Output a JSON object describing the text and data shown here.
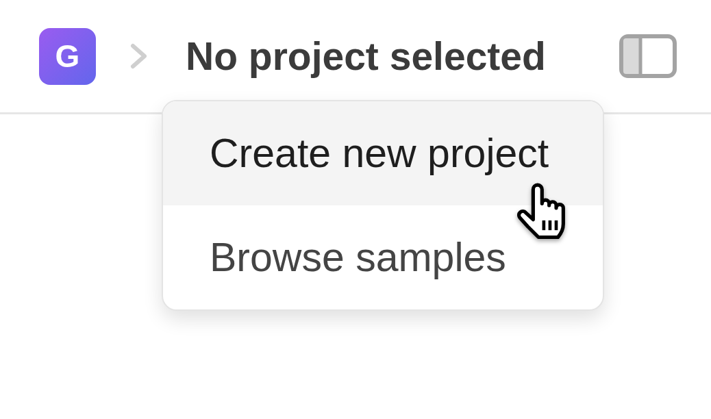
{
  "header": {
    "logo": {
      "letter": "G"
    },
    "title": "No project selected"
  },
  "menu": {
    "items": [
      {
        "label": "Create new project",
        "highlighted": true
      },
      {
        "label": "Browse samples",
        "highlighted": false
      }
    ]
  }
}
